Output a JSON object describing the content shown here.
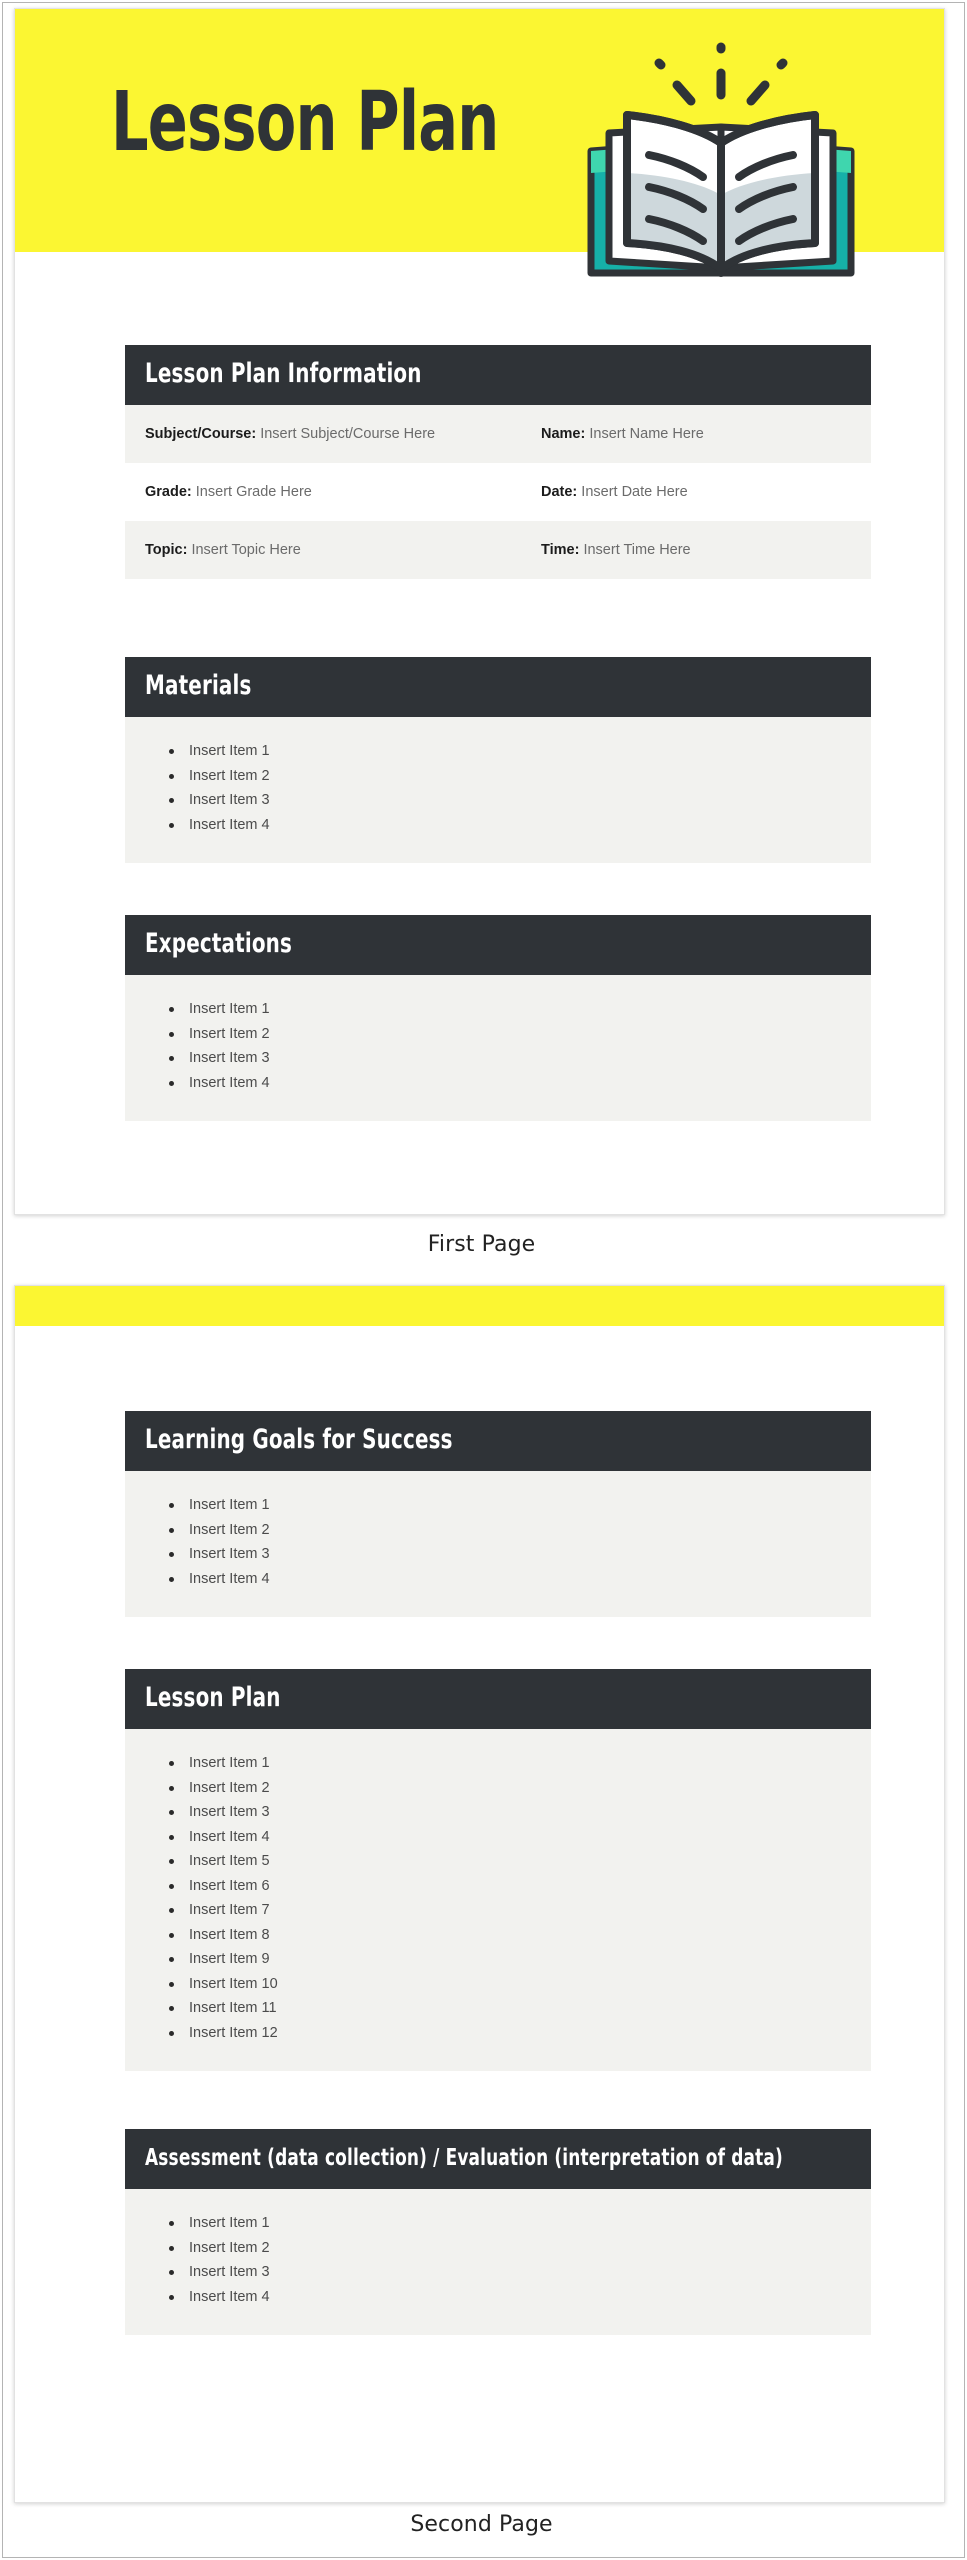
{
  "document": {
    "banner_color": "#fbf632",
    "header_color": "#2f3337",
    "body_color": "#f2f2ef",
    "title": "Lesson Plan"
  },
  "captions": {
    "first": "First Page",
    "second": "Second Page"
  },
  "illustration": {
    "name": "open-book-icon",
    "cover_color": "#16b0a8",
    "cover_highlight": "#3fd6ae",
    "page_color": "#ced8dc",
    "page_top_color": "#ffffff",
    "outline_color": "#2f3337"
  },
  "page1": {
    "info": {
      "header": "Lesson Plan Information",
      "rows": [
        {
          "left_label": "Subject/Course:",
          "left_value": "Insert Subject/Course Here",
          "right_label": "Name:",
          "right_value": "Insert Name Here"
        },
        {
          "left_label": "Grade:",
          "left_value": "Insert Grade Here",
          "right_label": "Date:",
          "right_value": "Insert Date Here"
        },
        {
          "left_label": "Topic:",
          "left_value": "Insert Topic Here",
          "right_label": "Time:",
          "right_value": "Insert Time Here"
        }
      ]
    },
    "materials": {
      "header": "Materials",
      "items": [
        "Insert Item 1",
        "Insert Item 2",
        "Insert Item 3",
        "Insert Item 4"
      ]
    },
    "expectations": {
      "header": "Expectations",
      "items": [
        "Insert Item 1",
        "Insert Item 2",
        "Insert Item 3",
        "Insert Item 4"
      ]
    }
  },
  "page2": {
    "learning_goals": {
      "header": "Learning Goals for Success",
      "items": [
        "Insert Item 1",
        "Insert Item 2",
        "Insert Item 3",
        "Insert Item 4"
      ]
    },
    "lesson_plan": {
      "header": "Lesson Plan",
      "items": [
        "Insert Item 1",
        "Insert Item 2",
        "Insert Item 3",
        "Insert Item 4",
        "Insert Item 5",
        "Insert Item 6",
        "Insert Item 7",
        "Insert Item 8",
        "Insert Item 9",
        "Insert Item 10",
        "Insert Item 11",
        "Insert Item 12"
      ]
    },
    "assessment": {
      "header": "Assessment (data collection) / Evaluation (interpretation of data)",
      "items": [
        "Insert Item 1",
        "Insert Item 2",
        "Insert Item 3",
        "Insert Item 4"
      ]
    }
  }
}
